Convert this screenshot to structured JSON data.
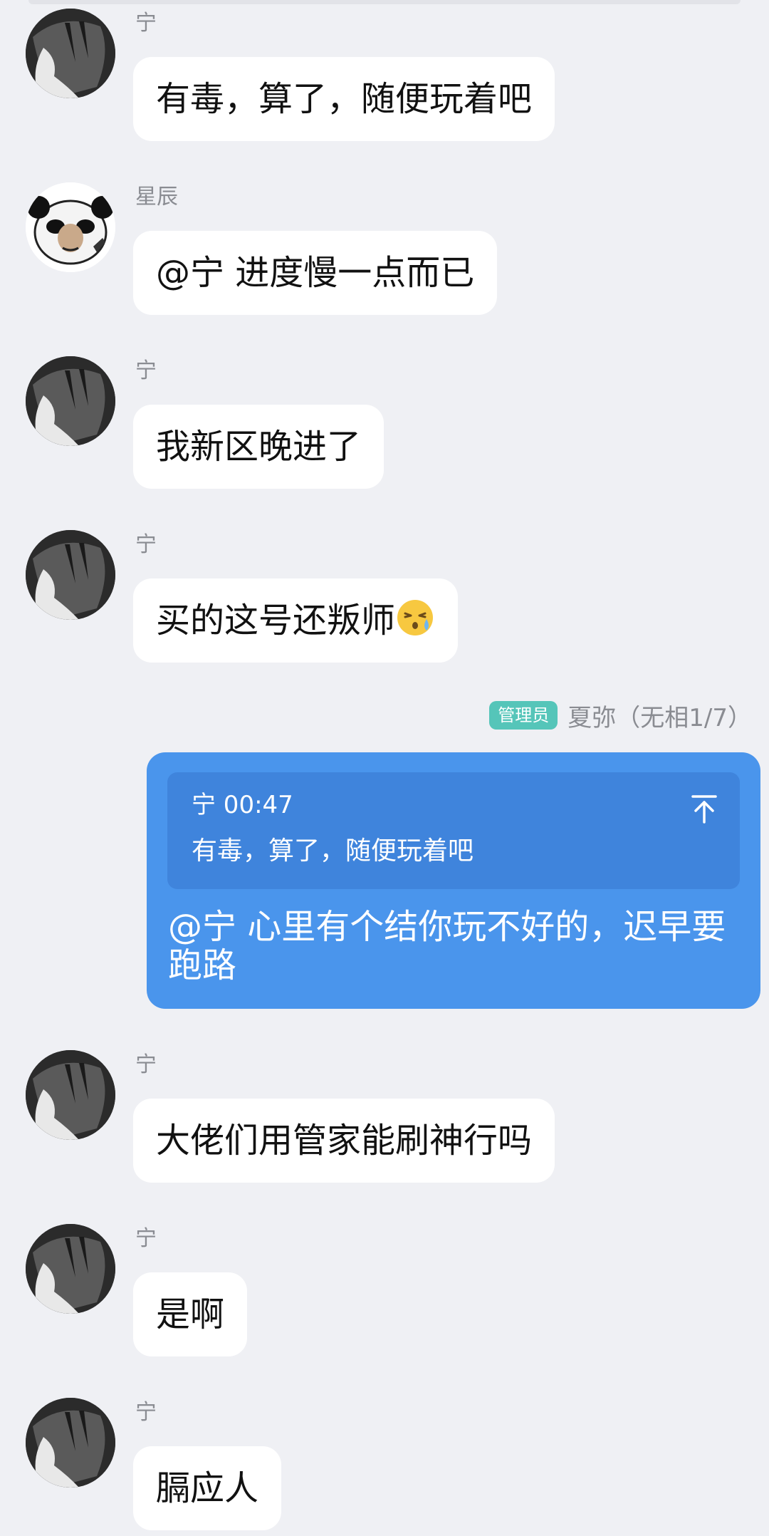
{
  "messages": [
    {
      "sender": "宁",
      "text": "有毒，算了，随便玩着吧"
    },
    {
      "sender": "星辰",
      "text": "@宁 进度慢一点而已"
    },
    {
      "sender": "宁",
      "text": "我新区晚进了"
    },
    {
      "sender": "宁",
      "text": "买的这号还叛师"
    },
    {
      "sender": "宁",
      "text": "大佬们用管家能刷神行吗"
    },
    {
      "sender": "宁",
      "text": "是啊"
    },
    {
      "sender": "宁",
      "text": "膈应人"
    }
  ],
  "self_message": {
    "badge": "管理员",
    "sender": "夏弥（无相1/7）",
    "quote_header": "宁 00:47",
    "quote_text": "有毒，算了，随便玩着吧",
    "text": "@宁 心里有个结你玩不好的，迟早要跑路"
  },
  "icons": {
    "emoji": "sweat-face-emoji",
    "quote_jump": "arrow-up-to-top-icon"
  },
  "colors": {
    "background": "#eff0f4",
    "self_bubble": "#4a95ec",
    "quote_block": "#3f84dc",
    "admin_badge": "#55c5b9"
  }
}
